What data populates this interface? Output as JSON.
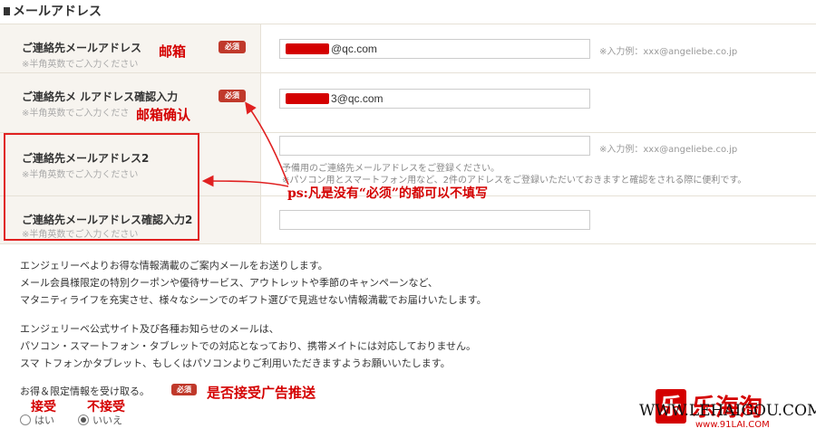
{
  "section": {
    "title": "メールアドレス"
  },
  "rows": [
    {
      "label": "ご連絡先メールアドレス",
      "sub": "※半角英数でご入力ください",
      "required": "必須",
      "value": "@qc.com",
      "example": "※入力例：xxx@angeliebe.co.jp"
    },
    {
      "label": "ご連絡先メ ルアドレス確認入力",
      "sub": "※半角英数でご入力くださ",
      "required": "必須",
      "value": "3@qc.com"
    },
    {
      "label": "ご連絡先メールアドレス2",
      "sub": "※半角英数でご入力ください",
      "value": "",
      "example": "※入力例：xxx@angeliebe.co.jp",
      "help1": "予備用のご連絡先メールアドレスをご登録ください。",
      "help2": "※パソコン用とスマートフォン用など、2件のアドレスをご登録いただいておきますと確認をされる際に便利です。"
    },
    {
      "label": "ご連絡先メールアドレス確認入力2",
      "sub": "※半角英数でご入力ください",
      "value": ""
    }
  ],
  "annotations": {
    "email": "邮箱",
    "confirm": "邮箱确认",
    "ps": "ps:凡是没有“必须”的都可以不填写",
    "ad": "是否接受广告推送",
    "accept": "接受",
    "reject": "不接受"
  },
  "paragraphs": {
    "p1": [
      "エンジェリーベよりお得な情報満載のご案内メールをお送りします。",
      "メール会員様限定の特別クーポンや優待サービス、アウトレットや季節のキャンペーンなど、",
      "マタニティライフを充実させ、様々なシーンでのギフト選びで見逃せない情報満載でお届けいたします。"
    ],
    "p2": [
      "エンジェリーベ公式サイト及び各種お知らせのメールは、",
      "パソコン・スマートフォン・タブレットでの対応となっており、携帯メイトには対応しておりません。",
      "スマ トフォンかタブレット、もしくはパソコンよりご利用いただきますようお願いいたします。"
    ]
  },
  "optin": {
    "label": "お得＆限定情報を受け取る。",
    "required": "必須",
    "options": [
      {
        "label": "はい",
        "selected": false
      },
      {
        "label": "いいえ",
        "selected": true
      }
    ]
  },
  "watermark": {
    "logo": "乐",
    "cn": "乐海淘",
    "url": "WWW.LEHAIGOU.COM",
    "url2": "www.91LAI.COM"
  },
  "colors": {
    "annotation": "#d40000",
    "required_badge": "#c0392b",
    "label_bg": "#f7f4ef"
  }
}
